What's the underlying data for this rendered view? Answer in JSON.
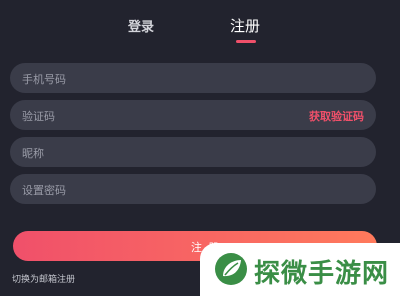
{
  "tabs": {
    "login": "登录",
    "register": "注册"
  },
  "fields": {
    "phone_placeholder": "手机号码",
    "code_placeholder": "验证码",
    "get_code_label": "获取验证码",
    "nickname_placeholder": "昵称",
    "password_placeholder": "设置密码"
  },
  "submit": {
    "label": "注册"
  },
  "switch_link": "切换为邮箱注册",
  "watermark": {
    "text": "探微手游网",
    "icon": "leaf-logo-icon",
    "color": "#3a8e46"
  },
  "colors": {
    "accent": "#f0506a",
    "background": "#22232e",
    "field": "#3a3c49"
  }
}
